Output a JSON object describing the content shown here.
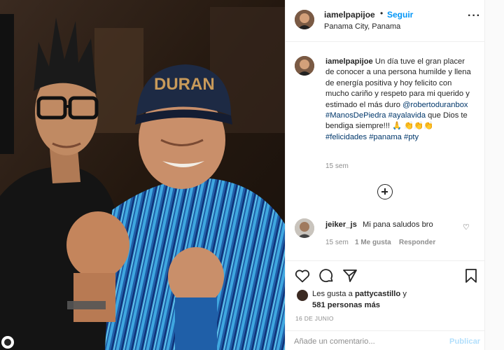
{
  "post": {
    "username": "iamelpapijoe",
    "dot": "•",
    "follow_label": "Seguir",
    "location": "Panama City, Panama",
    "more_label": "···",
    "caption_username": "iamelpapijoe",
    "caption_text_1": " Un día tuve el gran placer de conocer a una persona humilde y llena de energía positiva y hoy felicito con mucho cariño y respeto para mi querido y estimado el más duro ",
    "mention": "@robertoduranbox",
    "tag_manos": "#ManosDePiedra",
    "tag_ayala": "#ayalavida",
    "caption_text_2": " que Dios te bendiga siempre!!! 🙏 👏👏👏 ",
    "tag_felicidades": "#felicidades",
    "tag_panama": "#panama",
    "tag_pty": "#pty",
    "caption_time": "15 sem"
  },
  "comment": {
    "username": "jeiker_js",
    "text": "Mi pana saludos bro",
    "time": "15 sem",
    "likes": "1 Me gusta",
    "reply": "Responder"
  },
  "likes": {
    "prefix": "Les gusta a ",
    "user": "pattycastillo",
    "suffix": " y",
    "others": "581 personas más"
  },
  "date": "16 DE JUNIO",
  "add_comment": {
    "placeholder": "Añade un comentario...",
    "publish_label": "Publicar"
  },
  "icons": {
    "header_more": "more-icon",
    "load_more": "plus-circle-icon",
    "comment_like": "heart-icon",
    "like": "heart-icon",
    "comment": "comment-icon",
    "share": "share-icon",
    "save": "bookmark-icon"
  },
  "colors": {
    "link_blue": "#0095f6",
    "hashtag": "#00376b",
    "muted": "#8e8e8e",
    "publish_disabled": "#b2dffc"
  }
}
